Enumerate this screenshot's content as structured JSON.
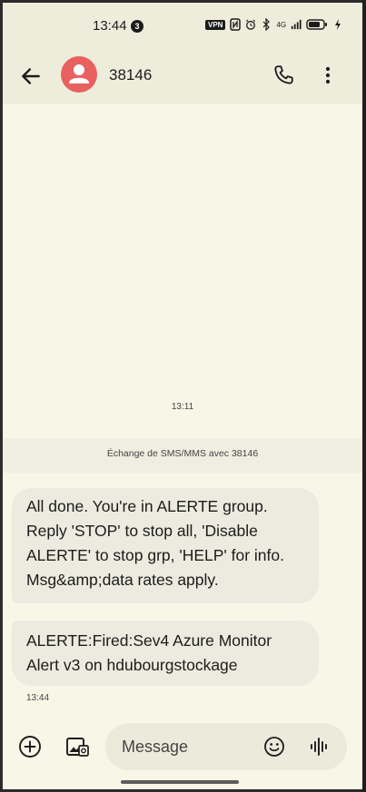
{
  "status_bar": {
    "time": "13:44",
    "notification_count": "3",
    "vpn_label": "VPN",
    "network_label": "4G",
    "icons": [
      "vpn-icon",
      "nfc-icon",
      "alarm-icon",
      "bluetooth-icon",
      "signal-icon",
      "battery-icon",
      "charging-icon"
    ]
  },
  "app_bar": {
    "contact_name": "38146",
    "avatar_color": "#e8605f",
    "icons": [
      "back-arrow-icon",
      "person-icon",
      "phone-icon",
      "more-vert-icon"
    ]
  },
  "conversation": {
    "top_timestamp": "13:11",
    "exchange_label": "Échange de SMS/MMS avec 38146",
    "messages": [
      {
        "lines": [
          "All done. You're in ALERTE group.",
          "Reply 'STOP' to stop all, 'Disable",
          "ALERTE' to stop grp, 'HELP' for info.",
          "Msg&amp;data rates apply."
        ]
      },
      {
        "lines": [
          "ALERTE:Fired:Sev4 Azure Monitor",
          "Alert v3 on hdubourgstockage"
        ]
      }
    ],
    "last_time": "13:44"
  },
  "compose": {
    "placeholder": "Message",
    "icons": [
      "add-circle-icon",
      "gallery-icon",
      "emoji-icon",
      "voice-icon"
    ]
  },
  "colors": {
    "background": "#f7f6e7",
    "bubble": "#ecebdf",
    "header": "#eeeddc"
  }
}
